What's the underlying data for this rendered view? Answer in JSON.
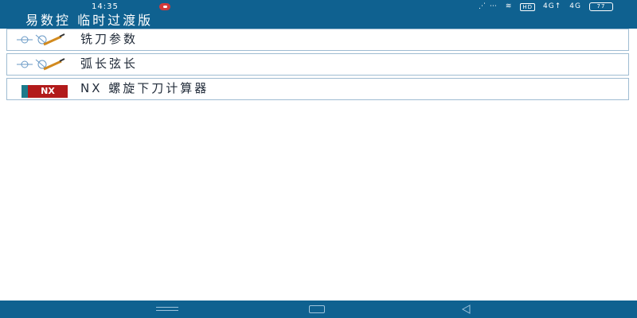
{
  "status_bar": {
    "time": "14:35",
    "right": [
      "⋰ ⋯",
      "≋",
      "HD",
      "4G↑",
      "4G"
    ],
    "battery": "77"
  },
  "app": {
    "title": "易数控 临时过渡版"
  },
  "menu": {
    "items": [
      {
        "label": "铣刀参数",
        "icon": "tool-parameter-icon"
      },
      {
        "label": "弧长弦长",
        "icon": "arc-chord-icon"
      },
      {
        "label": "NX 螺旋下刀计算器",
        "icon": "nx-badge-icon",
        "badge": "NX"
      }
    ]
  },
  "colors": {
    "bar": "#0f6190",
    "border": "#9fbcd2",
    "nx_red": "#b21b1b",
    "nx_teal": "#1c7a8b"
  },
  "nav": {
    "buttons": [
      "menu-icon",
      "home-icon",
      "back-icon"
    ]
  }
}
